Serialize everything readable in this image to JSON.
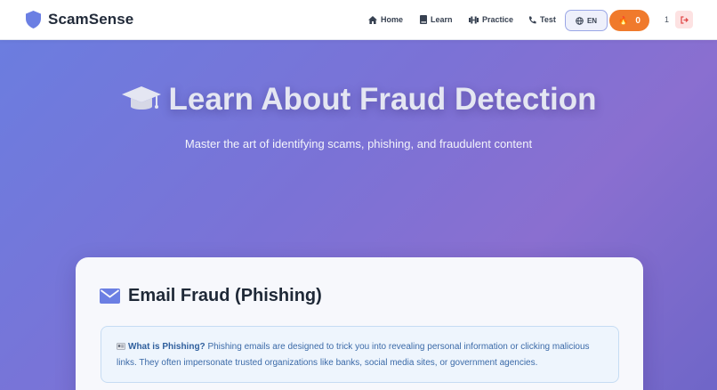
{
  "brand": {
    "name": "ScamSense",
    "icon": "shield-icon"
  },
  "nav": [
    {
      "label": "Home",
      "icon": "home-icon"
    },
    {
      "label": "Learn",
      "icon": "book-icon"
    },
    {
      "label": "Practice",
      "icon": "dumbbell-icon"
    },
    {
      "label": "Test",
      "icon": "phone-icon"
    }
  ],
  "language": {
    "label": "EN",
    "icon": "globe-icon"
  },
  "streak": {
    "icon": "flame-icon",
    "emoji": "🔥",
    "value": "0"
  },
  "user": {
    "count": "1",
    "logout_icon": "logout-icon"
  },
  "hero": {
    "icon": "graduation-cap-icon",
    "title": "Learn About Fraud Detection",
    "subtitle": "Master the art of identifying scams, phishing, and fraudulent content"
  },
  "section": {
    "icon": "envelope-icon",
    "title": "Email Fraud (Phishing)",
    "info_icon": "id-card-icon",
    "info_heading": "What is Phishing?",
    "info_text": " Phishing emails are designed to trick you into revealing personal information or clicking malicious links. They often impersonate trusted organizations like banks, social media sites, or government agencies."
  },
  "colors": {
    "accent": "#6a7ee0",
    "brand_shield": "#6b7fe3",
    "streak": "#f07a2c",
    "info_text": "#3b6aa8",
    "logout_bg": "#fde2e2"
  }
}
